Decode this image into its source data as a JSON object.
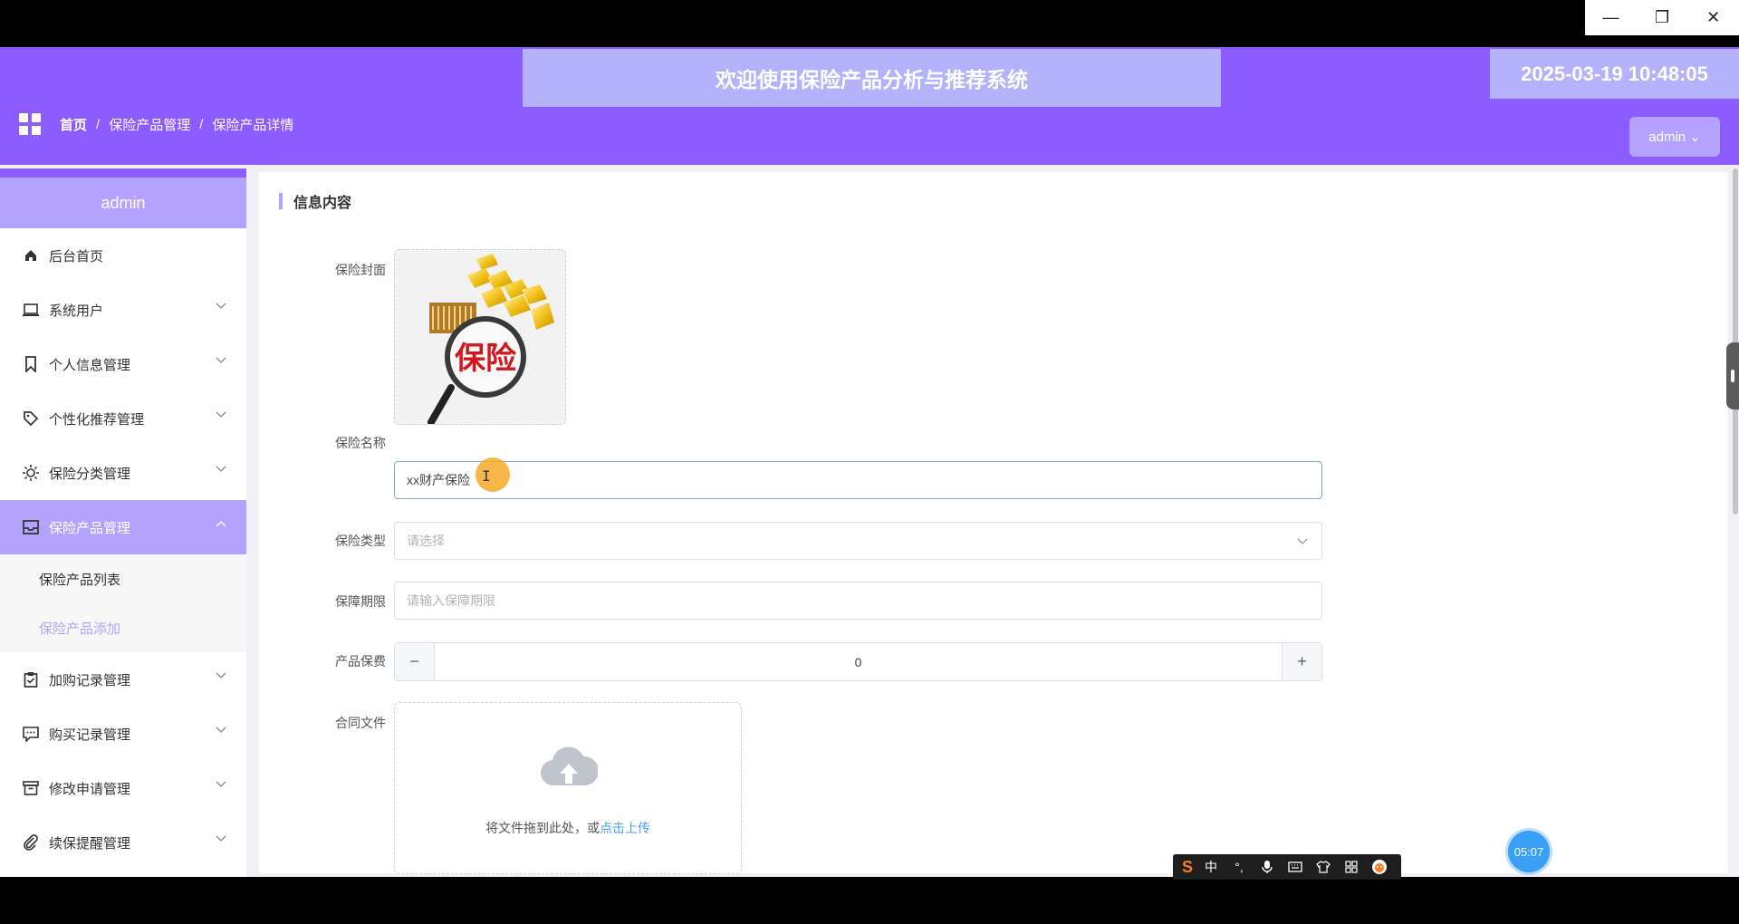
{
  "window": {
    "controls": {
      "minimize": "—",
      "restore": "❐",
      "close": "✕"
    }
  },
  "header": {
    "title": "欢迎使用保险产品分析与推荐系统",
    "datetime": "2025-03-19 10:48:05",
    "breadcrumb": [
      "首页",
      "保险产品管理",
      "保险产品详情"
    ],
    "breadcrumb_sep": "/",
    "user_button": "admin",
    "user_caret": "⌄"
  },
  "sidebar": {
    "user": "admin",
    "items": [
      {
        "label": "后台首页",
        "icon": "home-icon",
        "expandable": false
      },
      {
        "label": "系统用户",
        "icon": "laptop-icon",
        "expandable": true
      },
      {
        "label": "个人信息管理",
        "icon": "bookmark-icon",
        "expandable": true
      },
      {
        "label": "个性化推荐管理",
        "icon": "tag-icon",
        "expandable": true
      },
      {
        "label": "保险分类管理",
        "icon": "sun-icon",
        "expandable": true
      },
      {
        "label": "保险产品管理",
        "icon": "inbox-icon",
        "expandable": true,
        "active": true
      },
      {
        "label": "加购记录管理",
        "icon": "clipboard-icon",
        "expandable": true
      },
      {
        "label": "购买记录管理",
        "icon": "chat-icon",
        "expandable": true
      },
      {
        "label": "修改申请管理",
        "icon": "archive-icon",
        "expandable": true
      },
      {
        "label": "续保提醒管理",
        "icon": "paperclip-icon",
        "expandable": true
      }
    ],
    "sub_items": [
      {
        "label": "保险产品列表"
      },
      {
        "label": "保险产品添加",
        "current": true
      }
    ]
  },
  "content": {
    "section_title": "信息内容",
    "fields": {
      "cover": {
        "label": "保险封面",
        "image_text": "保险"
      },
      "name": {
        "label": "保险名称",
        "value": "xx财产保险"
      },
      "type": {
        "label": "保险类型",
        "placeholder": "请选择"
      },
      "period": {
        "label": "保障期限",
        "placeholder": "请输入保障期限"
      },
      "fee": {
        "label": "产品保费",
        "value": "0",
        "minus": "−",
        "plus": "+"
      },
      "contract": {
        "label": "合同文件",
        "upload_text": "将文件拖到此处，或",
        "upload_link": "点击上传"
      }
    }
  },
  "overlay": {
    "ime": {
      "logo": "S",
      "mode": "中",
      "punct": "°,"
    },
    "recording_time": "05:07",
    "cursor": "I"
  },
  "colors": {
    "header_bg": "#8c5cff",
    "accent_light": "#b3a3ff",
    "link": "#409eff"
  }
}
